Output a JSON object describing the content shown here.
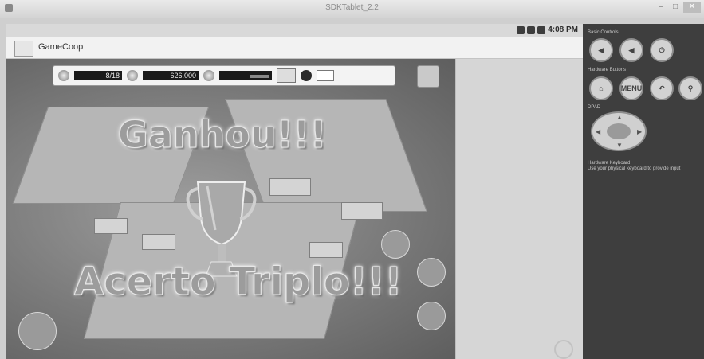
{
  "window": {
    "title": "SDKTablet_2.2"
  },
  "window_controls": {
    "minimize": "–",
    "maximize": "□",
    "close": "✕"
  },
  "statusbar": {
    "time": "4:08 PM"
  },
  "app": {
    "name": "GameCoop"
  },
  "hud": {
    "counter": "8/18",
    "money": "626.000"
  },
  "overlay": {
    "title": "Ganhou!!!",
    "subtitle": "Acerto Triplo!!!"
  },
  "controls": {
    "basic_label": "Basic Controls",
    "hardware_label": "Hardware Buttons",
    "dpad_label": "DPAD",
    "hw_menu": "MENU",
    "keyboard_label": "Hardware Keyboard",
    "keyboard_hint": "Use your physical keyboard to provide input"
  },
  "icons": {
    "basic": [
      "volume-down-icon",
      "volume-up-icon",
      "power-icon"
    ],
    "hardware": [
      "home-icon",
      "menu-button",
      "back-icon",
      "search-icon"
    ]
  }
}
